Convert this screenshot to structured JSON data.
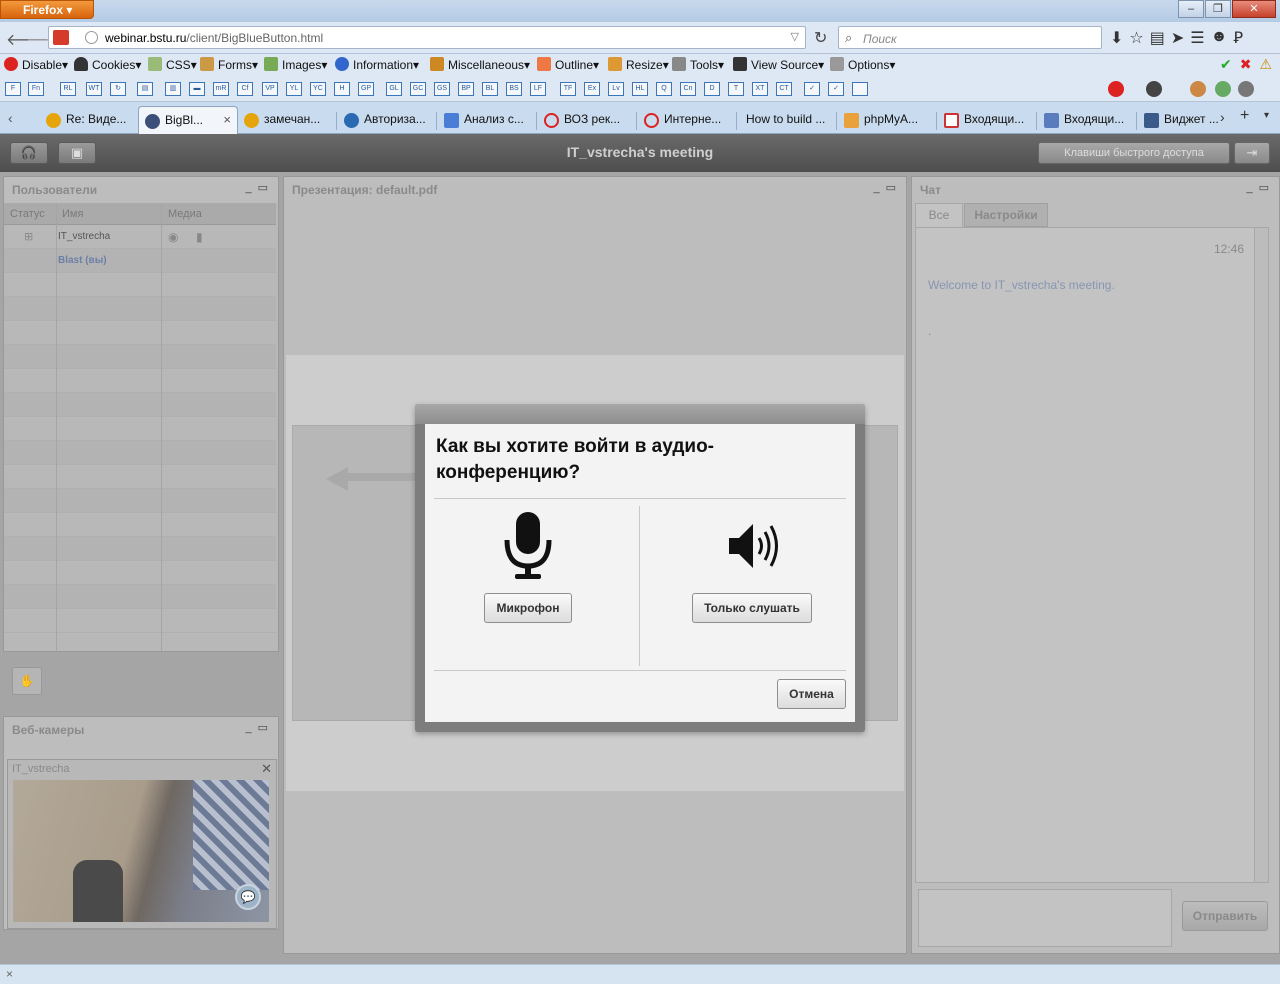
{
  "browser": {
    "menu_button": "Firefox",
    "url_host": "webinar.bstu.ru",
    "url_path": "/client/BigBlueButton.html",
    "search_placeholder": "Поиск"
  },
  "devbar": {
    "items": [
      "Disable",
      "Cookies",
      "CSS",
      "Forms",
      "Images",
      "Information",
      "Miscellaneous",
      "Outline",
      "Resize",
      "Tools",
      "View Source",
      "Options"
    ]
  },
  "wabar": {
    "boxes": [
      "F",
      "Fn",
      "RL",
      "WT",
      "↻",
      "▤",
      "▥",
      "▬",
      "mR",
      "Cf",
      "VP",
      "YL",
      "YC",
      "H",
      "GP",
      "GL",
      "GC",
      "GS",
      "BP",
      "BL",
      "BS",
      "LF",
      "TF",
      "Ex",
      "Lv",
      "HL",
      "Q",
      "Cn",
      "D",
      "T",
      "XT",
      "CT",
      "✓",
      "✓",
      ""
    ]
  },
  "tabs": [
    {
      "label": "Re: Виде..."
    },
    {
      "label": "BigBl..."
    },
    {
      "label": "замечан..."
    },
    {
      "label": "Авториза..."
    },
    {
      "label": "Анализ с..."
    },
    {
      "label": "ВОЗ рек..."
    },
    {
      "label": "Интерне..."
    },
    {
      "label": "How to build ..."
    },
    {
      "label": "phpMyA..."
    },
    {
      "label": "Входящи..."
    },
    {
      "label": "Входящи..."
    },
    {
      "label": "Виджет ..."
    }
  ],
  "app": {
    "meeting_title": "IT_vstrecha's meeting",
    "shortcut_button": "Клавиши быстрого доступа",
    "users_panel": {
      "title": "Пользователи",
      "col_status": "Статус",
      "col_name": "Имя",
      "col_media": "Медиа",
      "users": [
        {
          "name": "IT_vstrecha"
        },
        {
          "name": "Blast (вы)"
        }
      ]
    },
    "presentation_panel": {
      "title": "Презентация: default.pdf"
    },
    "webcams_panel": {
      "title": "Веб-камеры",
      "camera_name": "IT_vstrecha"
    },
    "chat_panel": {
      "title": "Чат",
      "tab_all": "Все",
      "tab_settings": "Настройки",
      "time": "12:46",
      "welcome": "Welcome to IT_vstrecha's meeting.",
      "dot": ".",
      "send_button": "Отправить"
    }
  },
  "dialog": {
    "title": "Как вы хотите войти в аудио-конференцию?",
    "microphone_button": "Микрофон",
    "listen_only_button": "Только слушать",
    "cancel_button": "Отмена"
  },
  "statusbar": {
    "close": "×"
  }
}
